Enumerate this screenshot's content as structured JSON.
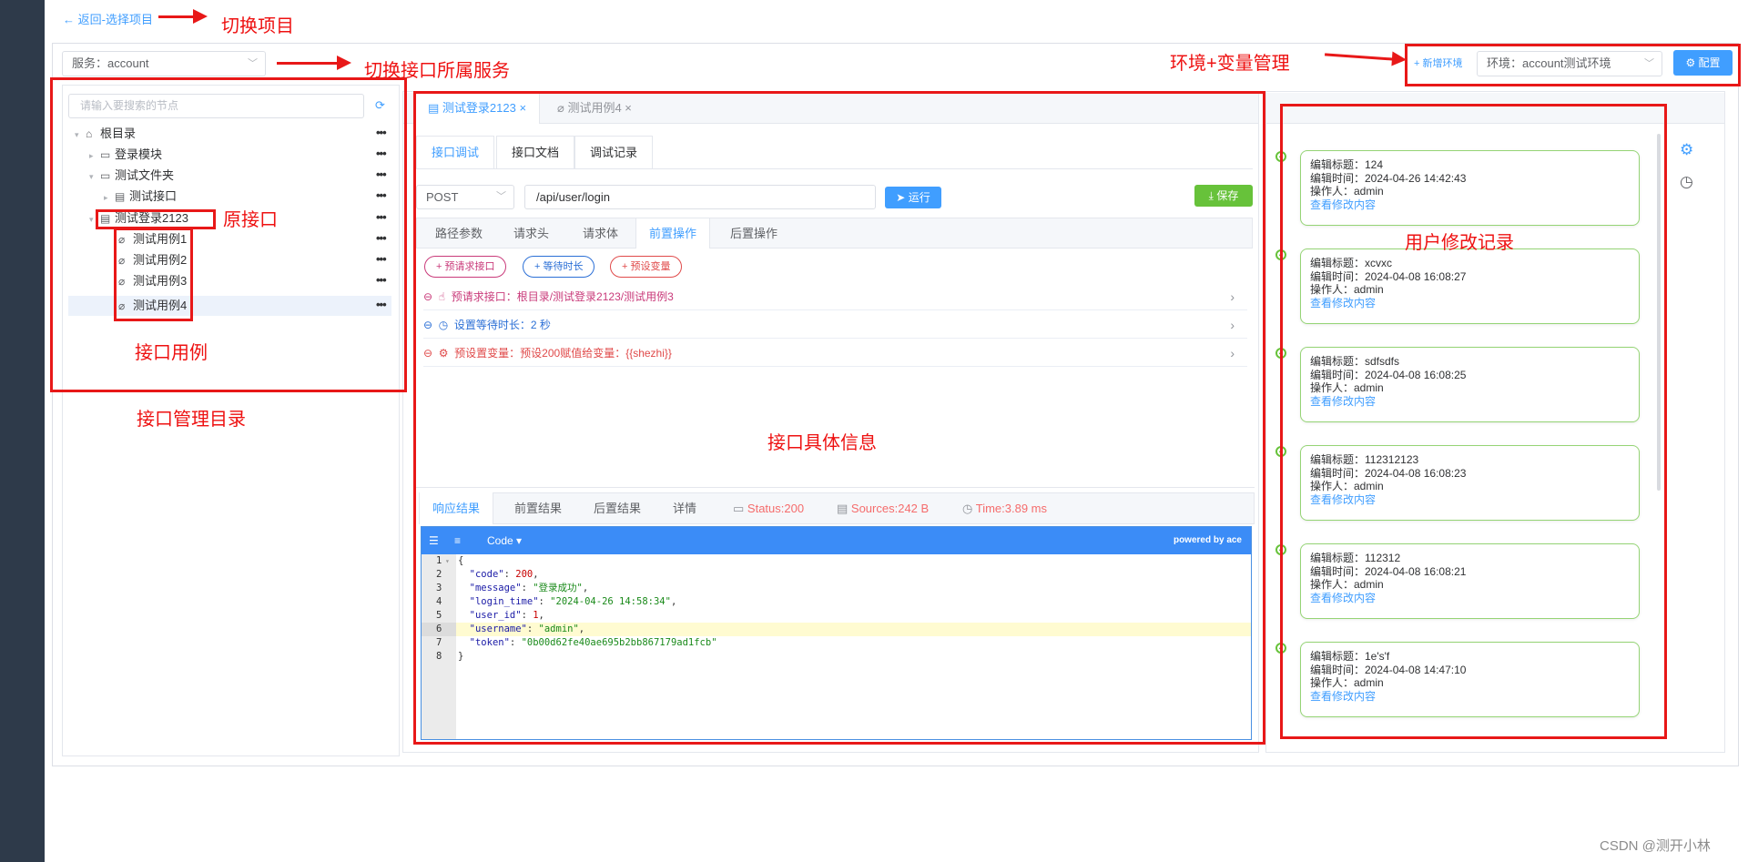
{
  "back_link": "← 返回-选择项目",
  "service_select": "服务：account",
  "env": {
    "add_label": "+ 新增环境",
    "select": "环境：account测试环境",
    "config_button": "⚙ 配置"
  },
  "tree": {
    "search_placeholder": "请输入要搜索的节点",
    "nodes": [
      {
        "label": "根目录"
      },
      {
        "label": "登录模块"
      },
      {
        "label": "测试文件夹"
      },
      {
        "label": "测试接口"
      },
      {
        "label": "测试登录2123"
      },
      {
        "label": "测试用例1"
      },
      {
        "label": "测试用例2"
      },
      {
        "label": "测试用例3"
      },
      {
        "label": "测试用例4"
      }
    ],
    "more": "•••"
  },
  "file_tabs": [
    {
      "label": "测试登录2123"
    },
    {
      "label": "测试用例4"
    }
  ],
  "sub_tabs": [
    "接口调试",
    "接口文档",
    "调试记录"
  ],
  "request": {
    "method": "POST",
    "url": "/api/user/login",
    "run_label": "运行",
    "save_label": "保存"
  },
  "param_tabs": [
    "路径参数",
    "请求头",
    "请求体",
    "前置操作",
    "后置操作"
  ],
  "pre_buttons": [
    "预请求接口",
    "等待时长",
    "预设变量"
  ],
  "pre_ops": [
    {
      "text": "预请求接口：根目录/测试登录2123/测试用例3",
      "color": "#c93a7a"
    },
    {
      "text": "设置等待时长：2 秒",
      "color": "#2b6fd6"
    },
    {
      "text": "预设置变量：预设200赋值给变量：{{shezhi}}",
      "color": "#e04a4a"
    }
  ],
  "result_tabs": [
    "响应结果",
    "前置结果",
    "后置结果",
    "详情"
  ],
  "result_stats": {
    "status": "Status:200",
    "sources": "Sources:242 B",
    "time": "Time:3.89 ms"
  },
  "editor": {
    "mode_label": "Code ▾",
    "powered": "powered by ace",
    "line_numbers": [
      "1",
      "2",
      "3",
      "4",
      "5",
      "6",
      "7",
      "8"
    ]
  },
  "response": {
    "code": "200",
    "message": "\"登录成功\"",
    "login_time": "\"2024-04-26 14:58:34\"",
    "user_id": "1",
    "username": "\"admin\"",
    "token": "\"0b00d62fe40ae695b2bb867179ad1fcb\""
  },
  "history": [
    {
      "title": "编辑标题：124",
      "time": "编辑时间：2024-04-26 14:42:43",
      "user": "操作人：admin",
      "link": "查看修改内容"
    },
    {
      "title": "编辑标题：xcvxc",
      "time": "编辑时间：2024-04-08 16:08:27",
      "user": "操作人：admin",
      "link": "查看修改内容"
    },
    {
      "title": "编辑标题：sdfsdfs",
      "time": "编辑时间：2024-04-08 16:08:25",
      "user": "操作人：admin",
      "link": "查看修改内容"
    },
    {
      "title": "编辑标题：112312123",
      "time": "编辑时间：2024-04-08 16:08:23",
      "user": "操作人：admin",
      "link": "查看修改内容"
    },
    {
      "title": "编辑标题：112312",
      "time": "编辑时间：2024-04-08 16:08:21",
      "user": "操作人：admin",
      "link": "查看修改内容"
    },
    {
      "title": "编辑标题：1e's'f",
      "time": "编辑时间：2024-04-08 14:47:10",
      "user": "操作人：admin",
      "link": "查看修改内容"
    }
  ],
  "annotations": {
    "switch_project": "切换项目",
    "switch_service": "切换接口所属服务",
    "env_manage": "环境+变量管理",
    "original_api": "原接口",
    "api_cases": "接口用例",
    "api_dir": "接口管理目录",
    "api_detail": "接口具体信息",
    "user_history": "用户修改记录"
  },
  "watermark": "CSDN @测开小林"
}
